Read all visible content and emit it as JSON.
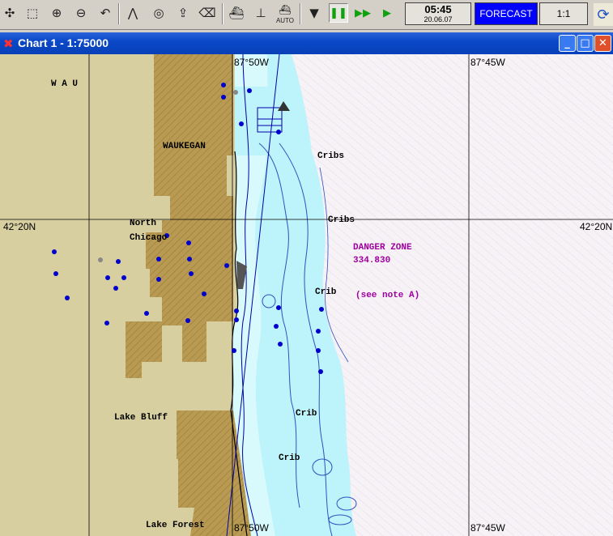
{
  "toolbar": {
    "buttons": [
      {
        "name": "pan-icon",
        "glyph": "✣"
      },
      {
        "name": "zoom-window-icon",
        "glyph": "⬚"
      },
      {
        "name": "zoom-in-icon",
        "glyph": "⊕"
      },
      {
        "name": "zoom-out-icon",
        "glyph": "⊖"
      },
      {
        "name": "undo-icon",
        "glyph": "↶"
      },
      {
        "name": "compass-icon",
        "glyph": "⋀"
      },
      {
        "name": "target-icon",
        "glyph": "◎"
      },
      {
        "name": "export-icon",
        "glyph": "⇪"
      },
      {
        "name": "erase-icon",
        "glyph": "⌫"
      },
      {
        "name": "ship-icon",
        "glyph": "⛴"
      },
      {
        "name": "route-icon",
        "glyph": "⊥"
      },
      {
        "name": "auto-ship-icon",
        "glyph": "⛴",
        "label": "AUTO"
      },
      {
        "name": "anchor-down-icon",
        "glyph": "▼"
      },
      {
        "name": "pause-icon",
        "glyph": "❚❚"
      },
      {
        "name": "fast-forward-icon",
        "glyph": "▶▶"
      },
      {
        "name": "play-icon",
        "glyph": "▶"
      }
    ],
    "clock_time": "05:45",
    "clock_date": "20.06.07",
    "forecast_label": "FORECAST",
    "scale_label": "1:1",
    "right_icon": "sync-icon"
  },
  "window": {
    "title": "Chart 1 - 1:75000",
    "minimize": "_",
    "maximize": "□",
    "close": "✕"
  },
  "colors": {
    "land": "#d8cfa0",
    "urban": "#b89a52",
    "shallow_water": "#bdf4fb",
    "deep_water": "#f6f2f6",
    "dots": "#0000cc",
    "magenta_text": "#a000a0"
  },
  "map": {
    "grid_labels": {
      "lon_top_left": "87°50W",
      "lon_top_right": "87°45W",
      "lon_bottom_left": "87°50W",
      "lon_bottom_right": "87°45W",
      "lat_left": "42°20N",
      "lat_right": "42°20N"
    },
    "places": {
      "wau": "W A U",
      "waukegan": "WAUKEGAN",
      "north": "North",
      "chicago": "Chicago",
      "lake_bluff": "Lake Bluff",
      "lake_forest": "Lake Forest"
    },
    "features": {
      "cribs_top": "Cribs",
      "cribs": "Cribs",
      "crib1": "Crib",
      "crib2": "Crib",
      "crib3": "Crib",
      "danger_zone": "DANGER ZONE",
      "danger_code": "334.830",
      "see_note": "(see note A)"
    }
  }
}
